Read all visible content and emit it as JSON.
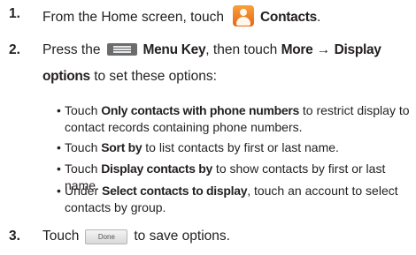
{
  "steps": [
    {
      "number": "1.",
      "text_before": "From the Home screen, touch",
      "icon": "contacts-app-icon",
      "bold": "Contacts",
      "text_after": "."
    },
    {
      "number": "2.",
      "text_before": "Press the",
      "icon": "menu-key-icon",
      "bold1": "Menu Key",
      "text_mid": ", then touch",
      "bold2": "More",
      "arrow": "→",
      "bold3": "Display",
      "bold4": "options",
      "text_after": "to set these options:"
    },
    {
      "number": "3.",
      "text_before": "Touch",
      "button_label": "Done",
      "text_after": "to save options."
    }
  ],
  "bullets": [
    {
      "pre": "Touch ",
      "bold": "Only contacts with phone numbers",
      "post": " to restrict display to",
      "line2": "contact records containing phone numbers."
    },
    {
      "pre": "Touch ",
      "bold": "Sort by",
      "post": " to list contacts by first or last name."
    },
    {
      "pre": "Touch ",
      "bold": "Display contacts by",
      "post": " to show contacts by first or last name."
    },
    {
      "pre": "Under ",
      "bold": "Select contacts to display",
      "post": ", touch an account to select",
      "line2": "contacts by group."
    }
  ],
  "bullet_char": "•"
}
